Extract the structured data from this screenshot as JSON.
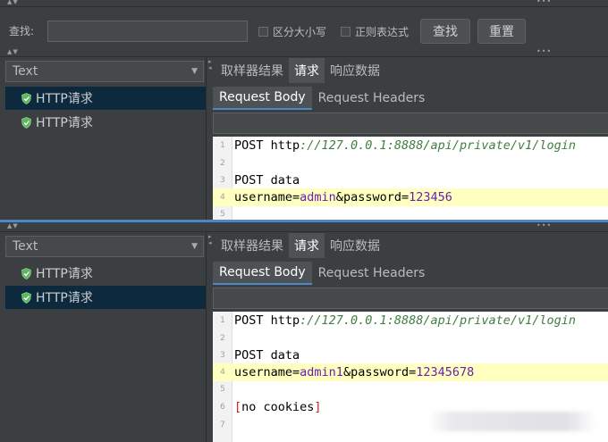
{
  "search": {
    "label": "查找:",
    "value": "",
    "case_sensitive_label": "区分大小写",
    "regex_label": "正则表达式",
    "find_button": "查找",
    "reset_button": "重置"
  },
  "panels": [
    {
      "renderer": "Text",
      "tree": [
        {
          "label": "HTTP请求",
          "selected": true
        },
        {
          "label": "HTTP请求",
          "selected": false
        }
      ],
      "tabs": [
        "取样器结果",
        "请求",
        "响应数据"
      ],
      "active_tab": "请求",
      "subtabs": [
        "Request Body",
        "Request Headers"
      ],
      "active_subtab": "Request Body",
      "lines": [
        {
          "num": "1",
          "method": "POST http",
          "url": "://127.0.0.1:8888/api/private/v1/login"
        },
        {
          "num": "2"
        },
        {
          "num": "3",
          "text": "POST data"
        },
        {
          "num": "4",
          "k1": "username=",
          "v1": "admin",
          "amp": "&",
          "k2": "password=",
          "v2": "123456"
        },
        {
          "num": "5"
        }
      ]
    },
    {
      "renderer": "Text",
      "tree": [
        {
          "label": "HTTP请求",
          "selected": false
        },
        {
          "label": "HTTP请求",
          "selected": true
        }
      ],
      "tabs": [
        "取样器结果",
        "请求",
        "响应数据"
      ],
      "active_tab": "请求",
      "subtabs": [
        "Request Body",
        "Request Headers"
      ],
      "active_subtab": "Request Body",
      "lines": [
        {
          "num": "1",
          "method": "POST http",
          "url": "://127.0.0.1:8888/api/private/v1/login"
        },
        {
          "num": "2"
        },
        {
          "num": "3",
          "text": "POST data"
        },
        {
          "num": "4",
          "k1": "username=",
          "v1": "admin1",
          "amp": "&",
          "k2": "password=",
          "v2": "12345678"
        },
        {
          "num": "5"
        },
        {
          "num": "6",
          "lb": "[",
          "cookies": "no cookies",
          "rb": "]"
        },
        {
          "num": "7"
        }
      ]
    }
  ],
  "colors": {
    "background": "#3c3f41",
    "selection": "#0d293e",
    "line_highlight": "#ffffc0",
    "url": "#3f7f3f",
    "value": "#6a1fb0"
  }
}
